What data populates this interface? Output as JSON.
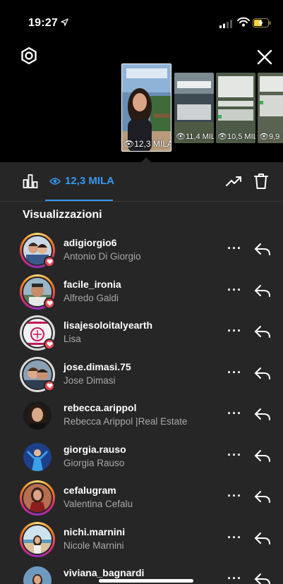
{
  "status_bar": {
    "time": "19:27"
  },
  "stories": [
    {
      "views": "12,3 MILA"
    },
    {
      "views": "11,4 MIL"
    },
    {
      "views": "10,5 MIL"
    },
    {
      "views": "9,9"
    }
  ],
  "toolbar": {
    "views_tab_label": "12,3 MILA"
  },
  "section_title": "Visualizzazioni",
  "viewers": [
    {
      "username": "adigiorgio6",
      "fullname": "Antonio Di Giorgio",
      "liked": true
    },
    {
      "username": "facile_ironia",
      "fullname": "Alfredo Galdi",
      "liked": true
    },
    {
      "username": "lisajesoloitalyearth",
      "fullname": "Lisa",
      "liked": true
    },
    {
      "username": "jose.dimasi.75",
      "fullname": "Jose Dimasi",
      "liked": true
    },
    {
      "username": "rebecca.arippol",
      "fullname": "Rebecca Arippol |Real Estate",
      "liked": false
    },
    {
      "username": "giorgia.rauso",
      "fullname": "Giorgia Rauso",
      "liked": false
    },
    {
      "username": "cefalugram",
      "fullname": "Valentina Cefalu",
      "liked": false
    },
    {
      "username": "nichi.marnini",
      "fullname": "Nicole Marnini",
      "liked": false
    },
    {
      "username": "viviana_bagnardi",
      "fullname": "",
      "liked": false
    }
  ],
  "more_label": "···",
  "colors": {
    "accent": "#3897f0",
    "sheet_bg": "#262626",
    "heart": "#ed4956",
    "secondary_text": "#a8a8a8"
  }
}
